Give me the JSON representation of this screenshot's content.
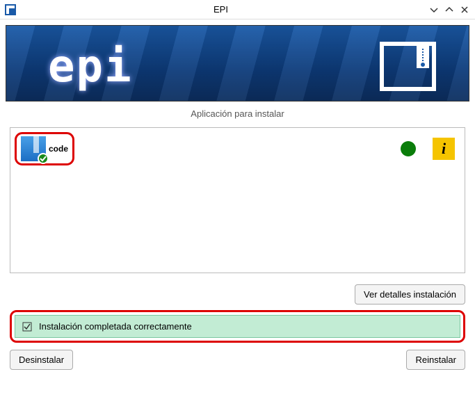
{
  "window": {
    "title": "EPI"
  },
  "subtitle": "Aplicación para instalar",
  "app": {
    "name": "code"
  },
  "buttons": {
    "details": "Ver detalles instalación",
    "uninstall": "Desinstalar",
    "reinstall": "Reinstalar"
  },
  "status": {
    "message": "Instalación completada correctamente"
  }
}
